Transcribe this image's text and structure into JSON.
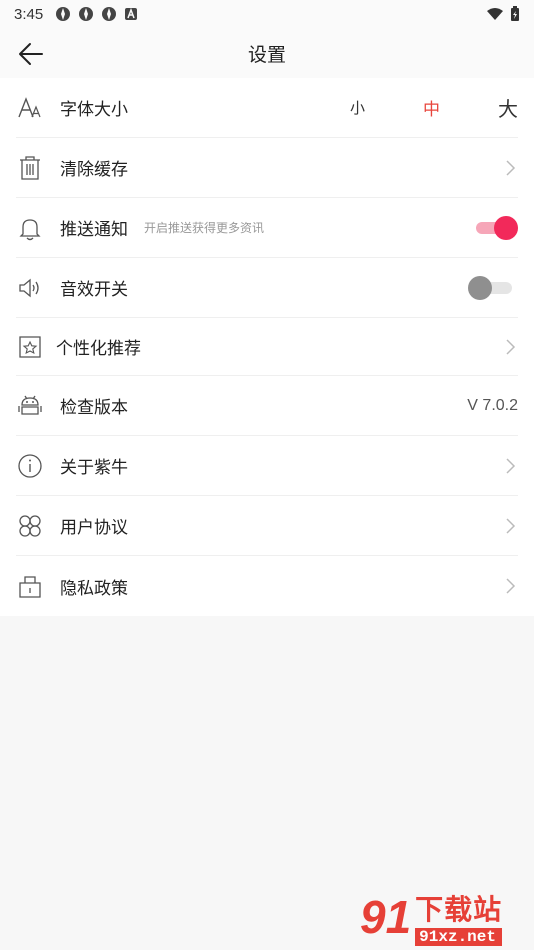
{
  "status": {
    "time": "3:45"
  },
  "header": {
    "title": "设置"
  },
  "font_size": {
    "label": "字体大小",
    "small": "小",
    "medium": "中",
    "large": "大",
    "selected": "中"
  },
  "clear_cache": {
    "label": "清除缓存"
  },
  "push": {
    "label": "推送通知",
    "sub": "开启推送获得更多资讯",
    "enabled": true
  },
  "sound": {
    "label": "音效开关",
    "enabled": false
  },
  "personal": {
    "label": "个性化推荐"
  },
  "version": {
    "label": "检查版本",
    "value": "V 7.0.2"
  },
  "about": {
    "label": "关于紫牛"
  },
  "agreement": {
    "label": "用户协议"
  },
  "privacy": {
    "label": "隐私政策"
  },
  "watermark": {
    "num": "91",
    "top": "下载站",
    "bottom": "91xz.net"
  },
  "colors": {
    "accent": "#e8453c",
    "toggle_on": "#f2295a",
    "toggle_off": "#8f8f8f"
  }
}
